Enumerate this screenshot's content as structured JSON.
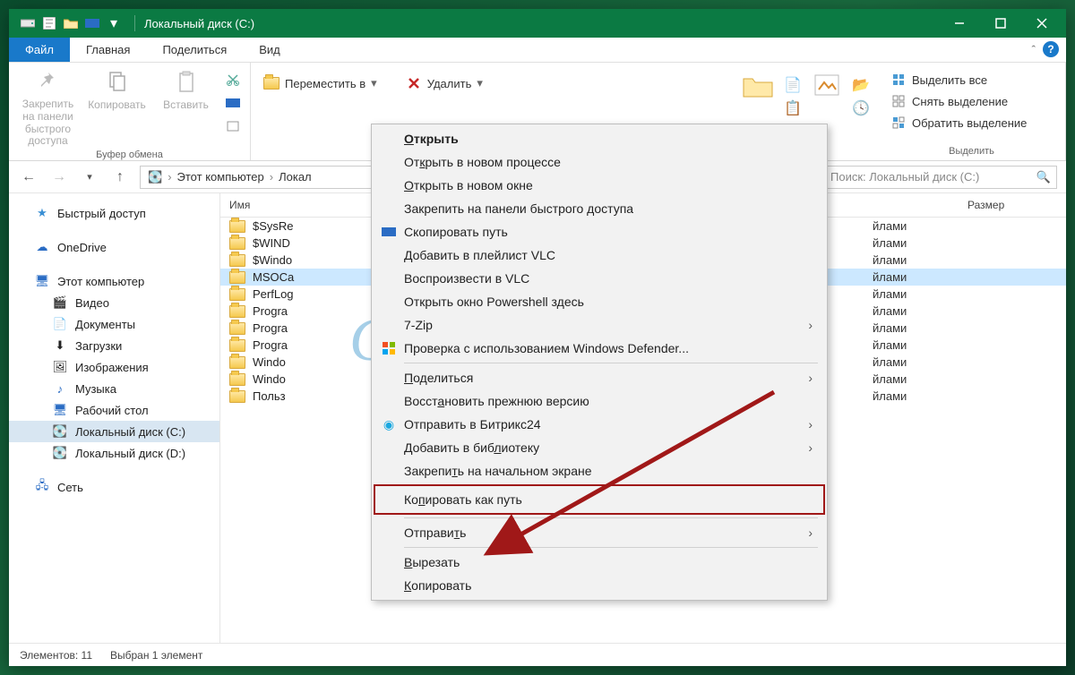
{
  "window": {
    "title": "Локальный диск (C:)"
  },
  "tabs": {
    "file": "Файл",
    "home": "Главная",
    "share": "Поделиться",
    "view": "Вид"
  },
  "ribbon": {
    "pin": "Закрепить на панели быстрого доступа",
    "copy": "Копировать",
    "paste": "Вставить",
    "move_to": "Переместить в",
    "delete": "Удалить",
    "select_all": "Выделить все",
    "select_none": "Снять выделение",
    "invert": "Обратить выделение",
    "grp_clipboard": "Буфер обмена",
    "grp_select": "Выделить"
  },
  "breadcrumb": {
    "pc": "Этот компьютер",
    "disk": "Локал"
  },
  "search": {
    "placeholder": "Поиск: Локальный диск (C:)"
  },
  "sidebar": {
    "quick": "Быстрый доступ",
    "onedrive": "OneDrive",
    "pc": "Этот компьютер",
    "video": "Видео",
    "docs": "Документы",
    "downloads": "Загрузки",
    "images": "Изображения",
    "music": "Музыка",
    "desktop": "Рабочий стол",
    "diskc": "Локальный диск (C:)",
    "diskd": "Локальный диск (D:)",
    "network": "Сеть"
  },
  "cols": {
    "name": "Имя",
    "size": "Размер"
  },
  "files": [
    {
      "n": "$SysRe",
      "t": "йлами"
    },
    {
      "n": "$WIND",
      "t": "йлами"
    },
    {
      "n": "$Windo",
      "t": "йлами"
    },
    {
      "n": "MSOCa",
      "t": "йлами",
      "sel": true
    },
    {
      "n": "PerfLog",
      "t": "йлами"
    },
    {
      "n": "Progra",
      "t": "йлами"
    },
    {
      "n": "Progra",
      "t": "йлами"
    },
    {
      "n": "Progra",
      "t": "йлами"
    },
    {
      "n": "Windo",
      "t": "йлами"
    },
    {
      "n": "Windo",
      "t": "йлами"
    },
    {
      "n": "Польз",
      "t": "йлами"
    }
  ],
  "ctx": {
    "open": "Открыть",
    "open_proc": "Открыть в новом процессе",
    "open_win": "Открыть в новом окне",
    "pin_quick": "Закрепить на панели быстрого доступа",
    "copy_path": "Скопировать путь",
    "vlc_add": "Добавить в плейлист VLC",
    "vlc_play": "Воспроизвести в VLC",
    "powershell": "Открыть окно Powershell здесь",
    "sevenzip": "7-Zip",
    "defender": "Проверка с использованием Windows Defender...",
    "share": "Поделиться",
    "restore": "Восстановить прежнюю версию",
    "bitrix": "Отправить в Битрикс24",
    "library": "Добавить в библиотеку",
    "pin_start": "Закрепить на начальном экране",
    "copy_as_path": "Копировать как путь",
    "send_to": "Отправить",
    "cut": "Вырезать",
    "copy2": "Копировать"
  },
  "status": {
    "count": "Элементов: 11",
    "sel": "Выбран 1 элемент"
  },
  "watermark": "G-ek.com"
}
